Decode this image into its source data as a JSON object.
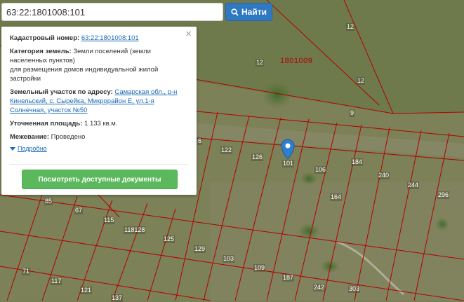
{
  "search": {
    "value": "63:22:1801008:101",
    "button_label": "Найти"
  },
  "popup": {
    "cadastral_label": "Кадастровый номер:",
    "cadastral_value": "63:22:1801008:101",
    "category_label": "Категория земель:",
    "category_value": "Земли поселений (земли населенных пунктов)",
    "category_value2": "для размещения домов индивидуальной жилой застройки",
    "address_label": "Земельный участок по адресу:",
    "address_value": "Самарская обл., р-н Кинельский, с. Сырейка, Микрорайон Е, ул.1-я Солнечная, участок №50",
    "area_label": "Уточненная площадь:",
    "area_value": "1 133 кв.м.",
    "survey_label": "Межевание:",
    "survey_value": "Проведено",
    "more_label": "Подробно",
    "docs_button": "Посмотреть доступные документы",
    "close": "×"
  },
  "map": {
    "quarter": "1801009",
    "labels": [
      "12",
      "12",
      "12",
      "9",
      "6",
      "122",
      "126",
      "101",
      "106",
      "184",
      "240",
      "244",
      "296",
      "164",
      "85",
      "67",
      "115",
      "118128",
      "125",
      "129",
      "103",
      "109",
      "187",
      "242",
      "303",
      "71",
      "117",
      "121",
      "137"
    ]
  },
  "colors": {
    "accent": "#2f79c2",
    "docs": "#5cb85c",
    "parcel_line": "#b40000",
    "link": "#1a6ab3"
  }
}
